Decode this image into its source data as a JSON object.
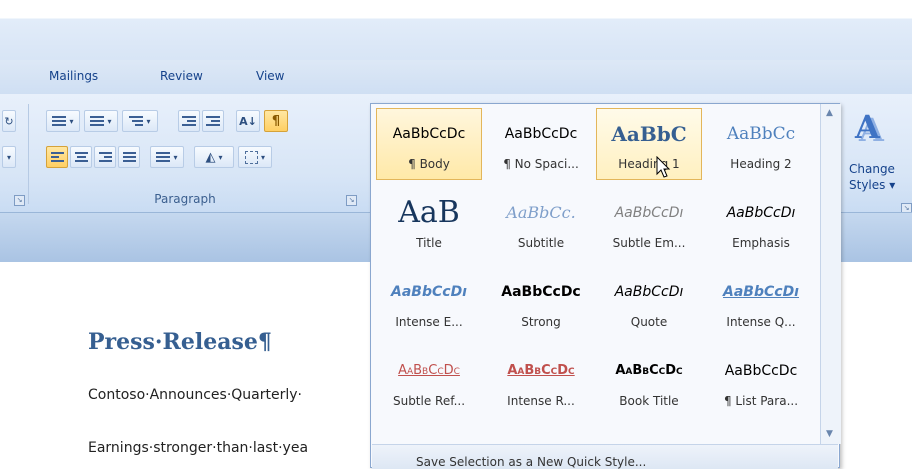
{
  "tabs": [
    "Mailings",
    "Review",
    "View"
  ],
  "paragraph_group": {
    "label": "Paragraph",
    "pilcrow": "¶",
    "sort_glyph": "A↓",
    "launcher": "↘"
  },
  "styles_gallery": {
    "rows": [
      [
        {
          "preview": "AaBbCcDc",
          "caption": "¶ Body",
          "state": "selected"
        },
        {
          "preview": "AaBbCcDc",
          "caption": "¶ No Spaci...",
          "state": "normal"
        },
        {
          "preview": "AaBbC",
          "caption": "Heading 1",
          "state": "hover"
        },
        {
          "preview": "AaBbCc",
          "caption": "Heading 2",
          "state": "normal"
        }
      ],
      [
        {
          "preview": "AaB",
          "caption": "Title",
          "state": "normal"
        },
        {
          "preview": "AaBbCc.",
          "caption": "Subtitle",
          "state": "normal"
        },
        {
          "preview": "AaBbCcDı",
          "caption": "Subtle Em...",
          "state": "normal"
        },
        {
          "preview": "AaBbCcDı",
          "caption": "Emphasis",
          "state": "normal"
        }
      ],
      [
        {
          "preview": "AaBbCcDı",
          "caption": "Intense E...",
          "state": "normal"
        },
        {
          "preview": "AaBbCcDc",
          "caption": "Strong",
          "state": "normal"
        },
        {
          "preview": "AaBbCcDı",
          "caption": "Quote",
          "state": "normal"
        },
        {
          "preview": "AaBbCcDı",
          "caption": "Intense Q...",
          "state": "normal"
        }
      ],
      [
        {
          "preview": "AaBbCcDc",
          "caption": "Subtle Ref...",
          "state": "normal"
        },
        {
          "preview": "AaBbCcDc",
          "caption": "Intense R...",
          "state": "normal"
        },
        {
          "preview": "AaBbCcDc",
          "caption": "Book Title",
          "state": "normal"
        },
        {
          "preview": "AaBbCcDc",
          "caption": "¶ List Para...",
          "state": "normal"
        }
      ]
    ],
    "footer_text": "Save Selection as a New Quick Style..."
  },
  "change_styles": {
    "line1": "Change",
    "line2": "Styles ▾",
    "icon_glyph": "A"
  },
  "document": {
    "title": "Press·Release¶",
    "line1": "Contoso·Announces·Quarterly·",
    "line2": "Earnings·stronger·than·last·yea"
  },
  "colors": {
    "accent": "#15428b",
    "heading": "#365f91",
    "selected_fill": "#ffe9a8"
  }
}
